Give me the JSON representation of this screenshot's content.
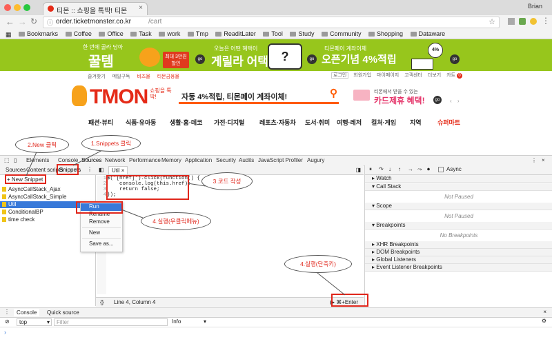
{
  "browser": {
    "tab_title": "티몬 :: 쇼핑을 톡딱! 티몬",
    "user": "Brian",
    "url_main": "order.ticketmonster.co.kr",
    "url_path": "/cart",
    "bookmarks": [
      "Bookmarks",
      "Coffee",
      "Office",
      "Task",
      "work",
      "Tmp",
      "ReaditLater",
      "Tool",
      "Study",
      "Community",
      "Shopping",
      "Dataware"
    ]
  },
  "banner": {
    "left_line1": "한 번에 골라 담아",
    "left_big": "꿀템",
    "left_badge": "최대 3만원 할인",
    "mid_line1": "오늘은 어떤 혜택이",
    "mid_big": "게릴라 어택",
    "right_line1": "티몬페이 계좌이체",
    "right_big": "오픈기념 4%적립",
    "right_badge": "4%",
    "go": "go"
  },
  "site": {
    "util_left": [
      "즐겨찾기",
      "메일구독",
      "비즈몰",
      "티몬금융몰"
    ],
    "util_right": [
      "로그인",
      "회원가입",
      "마이페이지",
      "고객센터",
      "더보기",
      "카트"
    ],
    "cart_count": "0",
    "logo": "TMON",
    "logo_sub": "쇼핑을 톡딱!",
    "search_text": "자동 4%적립, 티몬페이 계좌이체!",
    "promo_small": "티몬에서 받을 수 있는",
    "promo_big": "카드제휴 혜택!",
    "promo_go": "go",
    "categories": [
      "패션·뷰티",
      "식품·유아동",
      "생활·홈·데코",
      "가전·디지털",
      "레포츠·자동차",
      "도서·취미",
      "여행·레저",
      "컬처·게임",
      "지역",
      "슈퍼마트"
    ]
  },
  "devtools": {
    "top_tabs": [
      "Elements",
      "Console",
      "Sources",
      "Network",
      "Performance",
      "Memory",
      "Application",
      "Security",
      "Audits",
      "JavaScript Profiler",
      "Augury"
    ],
    "sub_tabs": [
      "Sources",
      "Content scripts",
      "Snippets"
    ],
    "new_snippet": "+ New Snippet",
    "snippets": [
      "AsyncCallStack_Ajax",
      "AsyncCallStack_Simple",
      "Util",
      "ConditionalBP",
      "time check"
    ],
    "editor_tab": "Util",
    "code": [
      "$('[href]').click(function() {",
      "    console.log(this.href);",
      "    return false;",
      "});"
    ],
    "status": "Line 4, Column 4",
    "braces": "{}",
    "run_shortcut": "▶ ⌘+Enter",
    "async_label": "Async",
    "right_sections": [
      "Watch",
      "Call Stack",
      "Scope",
      "Breakpoints",
      "XHR Breakpoints",
      "DOM Breakpoints",
      "Global Listeners",
      "Event Listener Breakpoints"
    ],
    "not_paused": "Not Paused",
    "no_breakpoints": "No Breakpoints",
    "context_menu": [
      "Run",
      "Rename",
      "Remove",
      "New",
      "Save as..."
    ],
    "drawer_tabs": [
      "Console",
      "Quick source"
    ],
    "context_select": "top",
    "filter_placeholder": "Filter",
    "level_select": "Info"
  },
  "annotations": {
    "new": "2.New 클릭",
    "snippets": "1.Snippets 클릭",
    "code": "3.코드 작성",
    "run_rightclick": "4.실행(우클릭메뉴)",
    "run_shortcut": "4.실행(단축키)"
  },
  "colors": {
    "tmon_red": "#e52b18",
    "banner_green": "#97c61c",
    "selection_blue": "#3879d9",
    "annotation_red": "#e0261b"
  }
}
